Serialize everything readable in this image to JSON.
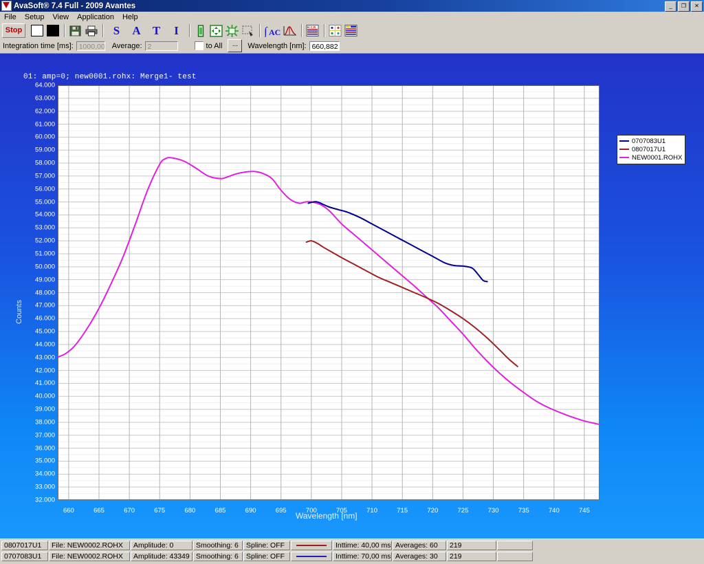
{
  "window": {
    "title": "AvaSoft® 7.4 Full - 2009 Avantes",
    "minimize_label": "_",
    "restore_label": "❐",
    "close_label": "✕"
  },
  "menu": {
    "items": [
      {
        "label": "File"
      },
      {
        "label": "Setup"
      },
      {
        "label": "View"
      },
      {
        "label": "Application"
      },
      {
        "label": "Help"
      }
    ]
  },
  "toolbar": {
    "stop_label": "Stop",
    "buttons": [
      {
        "name": "white-reference-button",
        "icon": "white-square-icon"
      },
      {
        "name": "dark-reference-button",
        "icon": "black-square-icon"
      },
      {
        "name": "save-button",
        "icon": "floppy-disk-icon"
      },
      {
        "name": "print-button",
        "icon": "printer-icon"
      },
      {
        "name": "scope-mode-button",
        "icon": "letter-s-icon",
        "label": "S"
      },
      {
        "name": "absorbance-mode-button",
        "icon": "letter-a-icon",
        "label": "A"
      },
      {
        "name": "transmittance-mode-button",
        "icon": "letter-t-icon",
        "label": "T"
      },
      {
        "name": "irradiance-mode-button",
        "icon": "letter-i-icon",
        "label": "I"
      },
      {
        "name": "strip-chart-button",
        "icon": "vial-icon"
      },
      {
        "name": "autoscale-button",
        "icon": "four-arrows-icon"
      },
      {
        "name": "zoom-reset-button",
        "icon": "green-star-icon"
      },
      {
        "name": "rubber-band-zoom-button",
        "icon": "dashed-rectangle-icon"
      },
      {
        "name": "integrate-button",
        "icon": "integral-ac-icon"
      },
      {
        "name": "peak-analysis-button",
        "icon": "peak-curve-icon"
      },
      {
        "name": "history-channel-button",
        "icon": "hcr-table-icon"
      },
      {
        "name": "color-measurement-button",
        "icon": "chromaticity-icon"
      },
      {
        "name": "multichannel-button",
        "icon": "multi-table-icon"
      }
    ]
  },
  "params": {
    "integration_time_label": "Integration time [ms]:",
    "integration_time_value": "1000,00",
    "average_label": "Average:",
    "average_value": "2",
    "to_all_label": "to All",
    "to_all_checked": false,
    "more_label": "...",
    "wavelength_label": "Wavelength [nm]:",
    "wavelength_value": "660,882"
  },
  "chart_data": {
    "type": "line",
    "title": "01: amp=0; new0001.rohx: Merge1- test",
    "xlabel": "Wavelength [nm]",
    "ylabel": "Counts",
    "xlim": [
      658.2,
      747.5
    ],
    "ylim": [
      32000,
      64000
    ],
    "ytick_step": 1000,
    "xtick_step": 5,
    "grid": true,
    "legend_position": "top-right outside",
    "ytick_labels": [
      "64.000",
      "63.000",
      "62.000",
      "61.000",
      "60.000",
      "59.000",
      "58.000",
      "57.000",
      "56.000",
      "55.000",
      "54.000",
      "53.000",
      "52.000",
      "51.000",
      "50.000",
      "49.000",
      "48.000",
      "47.000",
      "46.000",
      "45.000",
      "44.000",
      "43.000",
      "42.000",
      "41.000",
      "40.000",
      "39.000",
      "38.000",
      "37.000",
      "36.000",
      "35.000",
      "34.000",
      "33.000",
      "32.000"
    ],
    "ytick_values": [
      64000,
      63000,
      62000,
      61000,
      60000,
      59000,
      58000,
      57000,
      56000,
      55000,
      54000,
      53000,
      52000,
      51000,
      50000,
      49000,
      48000,
      47000,
      46000,
      45000,
      44000,
      43000,
      42000,
      41000,
      40000,
      39000,
      38000,
      37000,
      36000,
      35000,
      34000,
      33000,
      32000
    ],
    "xtick_labels": [
      "660",
      "665",
      "670",
      "675",
      "680",
      "685",
      "690",
      "695",
      "700",
      "705",
      "710",
      "715",
      "720",
      "725",
      "730",
      "735",
      "740",
      "745"
    ],
    "xtick_values": [
      660,
      665,
      670,
      675,
      680,
      685,
      690,
      695,
      700,
      705,
      710,
      715,
      720,
      725,
      730,
      735,
      740,
      745
    ],
    "series": [
      {
        "name": "0707083U1",
        "color": "#00008b",
        "x": [
          699.5,
          700.3,
          701.0,
          702.0,
          703.0,
          704.5,
          706.0,
          708.0,
          710.0,
          712.0,
          714.0,
          716.0,
          718.0,
          720.0,
          722.0,
          723.5,
          725.0,
          726.5,
          727.5,
          728.3,
          729.0
        ],
        "y": [
          54900,
          55000,
          55000,
          54800,
          54600,
          54400,
          54200,
          53800,
          53300,
          52800,
          52300,
          51800,
          51300,
          50800,
          50300,
          50100,
          50050,
          49900,
          49400,
          48950,
          48850
        ]
      },
      {
        "name": "0807017U1",
        "color": "#9e2020",
        "x": [
          699.2,
          700.0,
          701.0,
          702.0,
          703.5,
          705.0,
          707.0,
          709.0,
          711.0,
          713.0,
          715.0,
          717.0,
          719.0,
          721.0,
          723.0,
          725.0,
          727.0,
          729.0,
          731.0,
          732.5,
          734.0
        ],
        "y": [
          51900,
          52000,
          51800,
          51500,
          51100,
          50700,
          50200,
          49700,
          49200,
          48800,
          48400,
          48000,
          47600,
          47150,
          46600,
          46000,
          45300,
          44500,
          43600,
          42900,
          42300
        ]
      },
      {
        "name": "NEW0001.ROHX",
        "color": "#e020e0",
        "x": [
          658.3,
          659.5,
          661,
          663,
          665,
          667,
          669,
          671,
          673,
          675,
          676,
          677,
          679,
          681,
          683,
          685,
          686,
          687.5,
          689,
          690.5,
          692,
          693.5,
          695,
          696.5,
          698,
          699,
          700,
          701.5,
          703,
          705,
          707,
          709,
          711,
          713,
          715,
          717,
          719,
          721,
          723,
          725,
          727,
          729,
          731,
          733,
          735,
          737,
          739,
          741,
          743,
          745,
          747.3
        ],
        "y": [
          43050,
          43300,
          43900,
          45200,
          46800,
          48700,
          50800,
          53300,
          55900,
          57900,
          58350,
          58400,
          58150,
          57600,
          57000,
          56800,
          56900,
          57150,
          57300,
          57350,
          57200,
          56800,
          55900,
          55200,
          54900,
          55000,
          55000,
          54800,
          54300,
          53300,
          52500,
          51700,
          50900,
          50100,
          49300,
          48500,
          47650,
          46800,
          45800,
          44800,
          43700,
          42700,
          41800,
          41000,
          40300,
          39650,
          39150,
          38750,
          38400,
          38100,
          37850
        ]
      }
    ]
  },
  "status_rows": [
    {
      "id": "0807017U1",
      "file": "File: NEW0002.ROHX",
      "amplitude": "Amplitude: 0",
      "smoothing": "Smoothing: 6",
      "spline": "Spline: OFF",
      "color": "#9e2020",
      "inttime": "Inttime: 40,00 ms",
      "averages": "Averages: 60",
      "count": "219",
      "extra": ""
    },
    {
      "id": "0707083U1",
      "file": "File: NEW0002.ROHX",
      "amplitude": "Amplitude: 43349",
      "smoothing": "Smoothing: 6",
      "spline": "Spline: OFF",
      "color": "#2020c0",
      "inttime": "Inttime: 70,00 ms",
      "averages": "Averages: 30",
      "count": "219",
      "extra": ""
    }
  ]
}
